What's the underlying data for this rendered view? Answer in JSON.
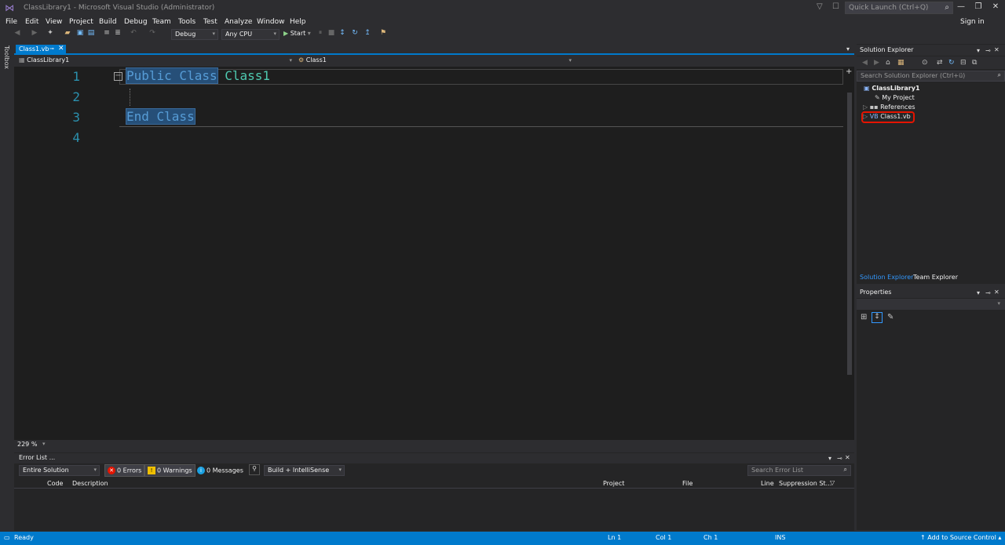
{
  "window": {
    "title": "ClassLibrary1 - Microsoft Visual Studio  (Administrator)",
    "quick_launch_placeholder": "Quick Launch (Ctrl+Q)",
    "sign_in": "Sign in"
  },
  "menu": [
    "File",
    "Edit",
    "View",
    "Project",
    "Build",
    "Debug",
    "Team",
    "Tools",
    "Test",
    "Analyze",
    "Window",
    "Help"
  ],
  "toolbar": {
    "config": "Debug",
    "platform": "Any CPU",
    "start": "Start"
  },
  "toolbox_label": "Toolbox",
  "document": {
    "tab": "Class1.vb",
    "nav_project": "ClassLibrary1",
    "nav_class": "Class1"
  },
  "code": {
    "line_numbers": [
      "1",
      "2",
      "3",
      "4"
    ],
    "line1_kw": "Public Class",
    "line1_name": "Class1",
    "line3_kw": "End Class"
  },
  "zoom": "229 %",
  "error_list": {
    "title": "Error List ...",
    "scope": "Entire Solution",
    "errors": "0 Errors",
    "warnings": "0 Warnings",
    "messages": "0 Messages",
    "build_filter": "Build + IntelliSense",
    "search_placeholder": "Search Error List",
    "columns": {
      "code": "Code",
      "description": "Description",
      "project": "Project",
      "file": "File",
      "line": "Line",
      "suppression": "Suppression St..."
    }
  },
  "solution_explorer": {
    "title": "Solution Explorer",
    "search_placeholder": "Search Solution Explorer (Ctrl+ü)",
    "project": "ClassLibrary1",
    "items": [
      "My Project",
      "References",
      "Class1.vb"
    ],
    "tabs": [
      "Solution Explorer",
      "Team Explorer"
    ]
  },
  "properties": {
    "title": "Properties"
  },
  "status": {
    "ready": "Ready",
    "ln": "Ln 1",
    "col": "Col 1",
    "ch": "Ch 1",
    "ins": "INS",
    "source_control": "Add to Source Control"
  },
  "colors": {
    "accent": "#007acc",
    "keyword": "#569cd6",
    "type": "#4ec9b0",
    "line_number": "#2b91af",
    "highlight_ring": "#e51400"
  }
}
